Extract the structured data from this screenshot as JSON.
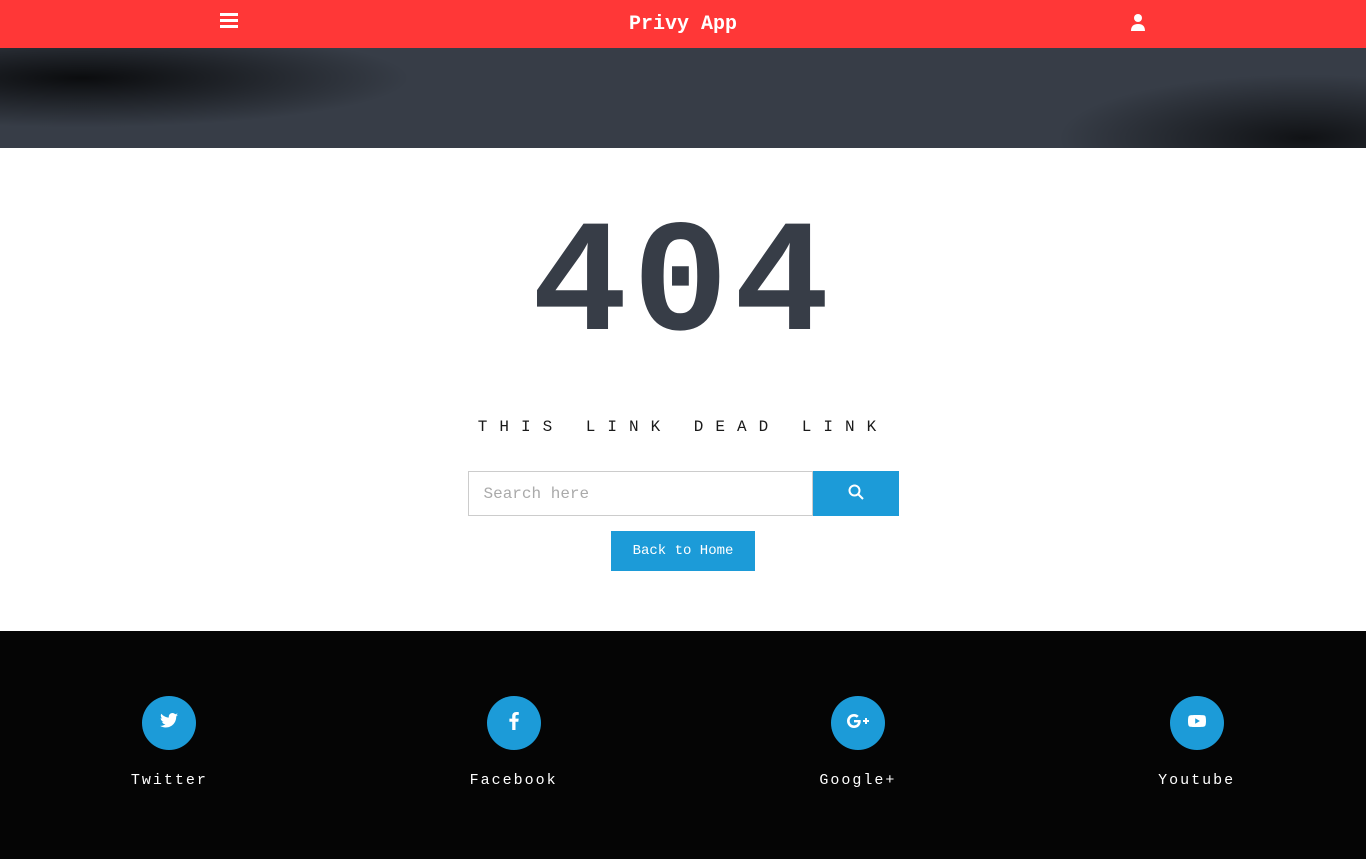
{
  "header": {
    "title": "Privy App"
  },
  "error": {
    "code": "404",
    "message": "THIS LINK DEAD LINK",
    "search_placeholder": "Search here",
    "back_label": "Back to Home"
  },
  "social": [
    {
      "name": "Twitter"
    },
    {
      "name": "Facebook"
    },
    {
      "name": "Google+"
    },
    {
      "name": "Youtube"
    }
  ]
}
